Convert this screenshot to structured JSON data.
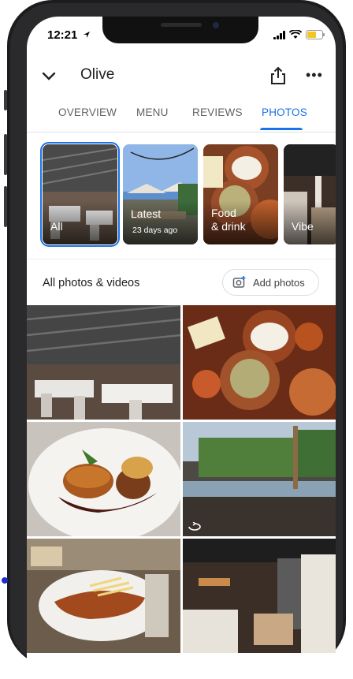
{
  "status_bar": {
    "time": "12:21"
  },
  "header": {
    "title": "Olive"
  },
  "tabs": [
    {
      "label": "OVERVIEW",
      "active": false
    },
    {
      "label": "MENU",
      "active": false
    },
    {
      "label": "REVIEWS",
      "active": false
    },
    {
      "label": "PHOTOS",
      "active": true
    }
  ],
  "albums": [
    {
      "label": "All",
      "sublabel": "",
      "selected": true
    },
    {
      "label": "Latest",
      "sublabel": "23 days ago",
      "selected": false
    },
    {
      "label": "Food\n& drink",
      "sublabel": "",
      "selected": false
    },
    {
      "label": "Vibe",
      "sublabel": "",
      "selected": false
    }
  ],
  "photos_section": {
    "title": "All photos & videos",
    "add_label": "Add photos"
  },
  "colors": {
    "accent": "#1a73e8",
    "text": "#202124",
    "muted": "#5f6368"
  },
  "icons": [
    "chevron-down-icon",
    "share-icon",
    "more-icon",
    "add-photo-icon",
    "video-360-icon"
  ]
}
